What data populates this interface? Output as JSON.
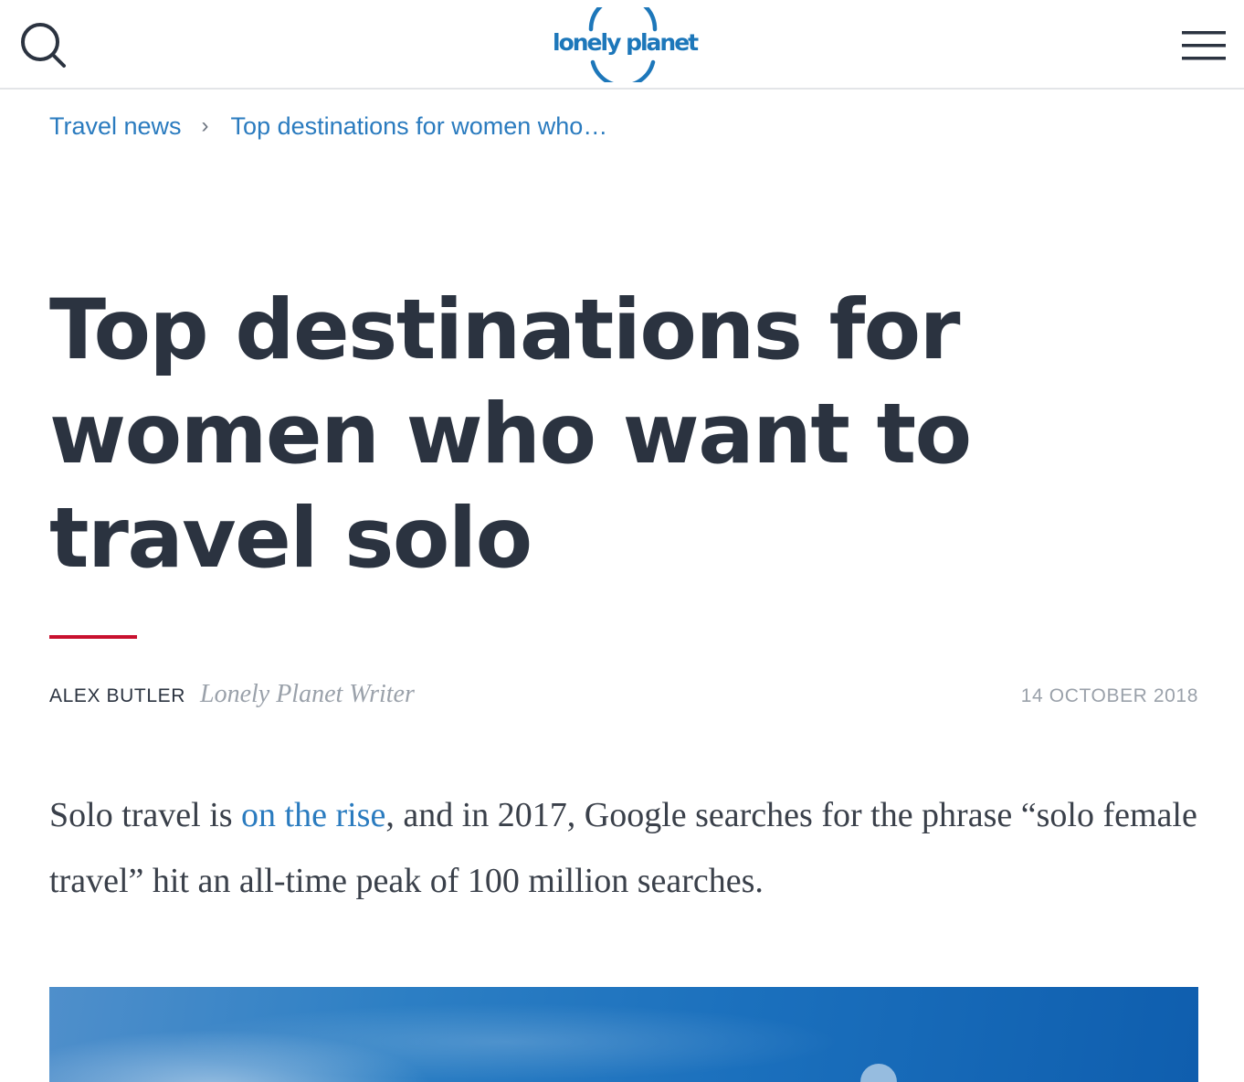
{
  "header": {
    "logo_text": "lonely planet",
    "search_icon": "search-icon",
    "menu_icon": "hamburger-menu-icon",
    "brand_color": "#1d77ba"
  },
  "breadcrumb": {
    "items": [
      {
        "label": "Travel news"
      },
      {
        "label": "Top destinations for women who…"
      }
    ],
    "separator": "›"
  },
  "article": {
    "title": "Top destinations for women who want to travel solo",
    "accent_color": "#c8102e",
    "author": "ALEX BUTLER",
    "author_role": "Lonely Planet Writer",
    "date": "14 OCTOBER 2018",
    "intro": {
      "before_link": "Solo travel is ",
      "link_text": "on the rise",
      "after_link": ", and in 2017, Google searches for the phrase “solo female travel” hit an all-time peak of 100 million searches."
    },
    "hero_image": "sky-photo"
  },
  "colors": {
    "text": "#2b3340",
    "link": "#2a7bbf",
    "muted": "#9aa1aa"
  }
}
